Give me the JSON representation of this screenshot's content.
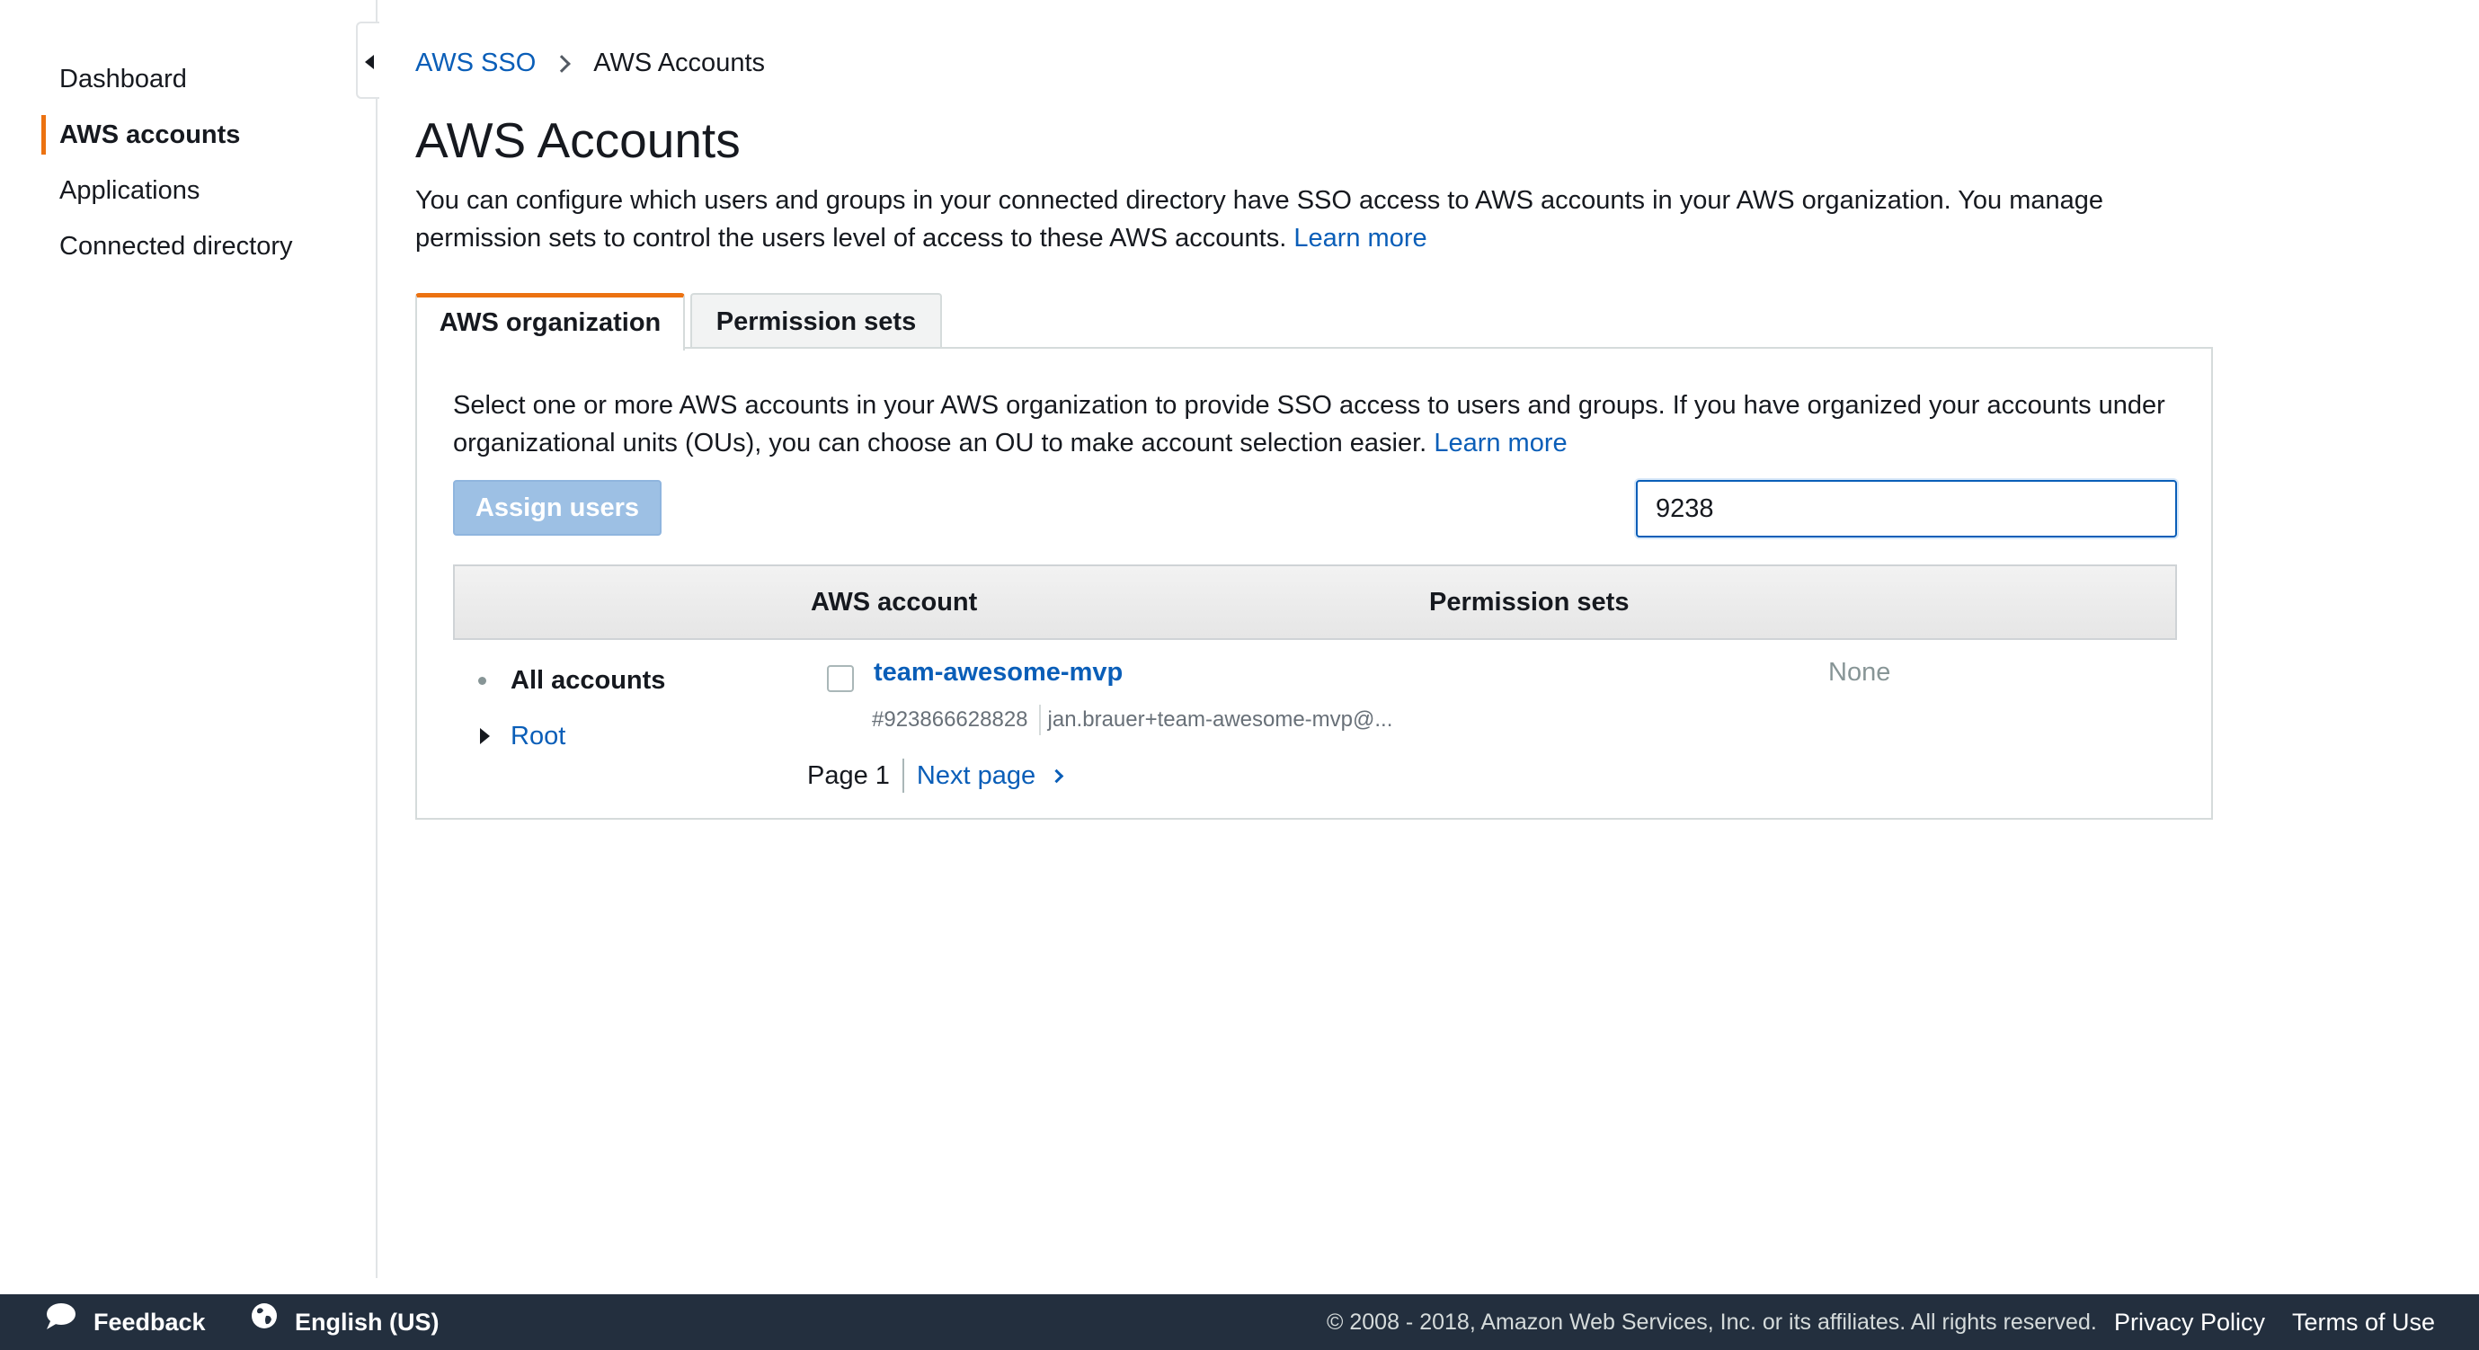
{
  "sidebar": {
    "items": [
      {
        "label": "Dashboard",
        "active": false
      },
      {
        "label": "AWS accounts",
        "active": true
      },
      {
        "label": "Applications",
        "active": false
      },
      {
        "label": "Connected directory",
        "active": false
      }
    ]
  },
  "breadcrumb": {
    "root": "AWS SSO",
    "current": "AWS Accounts"
  },
  "page": {
    "title": "AWS Accounts",
    "description": "You can configure which users and groups in your connected directory have SSO access to AWS accounts in your AWS organization. You manage permission sets to control the users level of access to these AWS accounts.",
    "learn_more": "Learn more"
  },
  "tabs": [
    {
      "label": "AWS organization",
      "active": true
    },
    {
      "label": "Permission sets",
      "active": false
    }
  ],
  "panel": {
    "description": "Select one or more AWS accounts in your AWS organization to provide SSO access to users and groups. If you have organized your accounts under organizational units (OUs), you can choose an OU to make account selection easier.",
    "learn_more": "Learn more",
    "assign_button": "Assign users",
    "search_value": "9238"
  },
  "table": {
    "columns": [
      "AWS account",
      "Permission sets"
    ],
    "tree": {
      "all_accounts": "All accounts",
      "root": "Root"
    },
    "rows": [
      {
        "name": "team-awesome-mvp",
        "id": "#923866628828",
        "email": "jan.brauer+team-awesome-mvp@...",
        "permission_sets": "None"
      }
    ]
  },
  "pagination": {
    "page": "Page 1",
    "next": "Next page"
  },
  "footer": {
    "feedback": "Feedback",
    "language": "English (US)",
    "copyright": "© 2008 - 2018, Amazon Web Services, Inc. or its affiliates. All rights reserved.",
    "privacy": "Privacy Policy",
    "terms": "Terms of Use"
  },
  "colors": {
    "accent": "#ec7211",
    "link": "#0a5eb8",
    "footer_bg": "#232f3e"
  }
}
